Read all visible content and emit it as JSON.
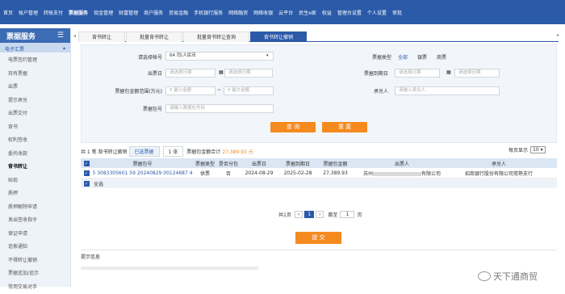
{
  "nav": [
    "首页",
    "账户管理",
    "转账支付",
    "票据服务",
    "现金管理",
    "财富管理",
    "商户服务",
    "贸易金融",
    "手机银行服务",
    "网络融资",
    "网络收银",
    "云平台",
    "民生e家",
    "权益",
    "管理台设置",
    "个人设置",
    "审批"
  ],
  "sidebar": {
    "title": "票据服务",
    "section": "电子汇票",
    "items": [
      "电票签约管理",
      "持有票据",
      "出票",
      "提示承兑",
      "出票交付",
      "背书",
      "权利签收",
      "委托收款",
      "背书转让",
      "贴现",
      "质押",
      "质押解除申请",
      "发出签收指令",
      "保证申请",
      "追索通知",
      "不得转让撤销",
      "票据追加/追示",
      "常用交易对手"
    ]
  },
  "tabs": [
    "背书转让",
    "批量背书转让",
    "批量背书转让查询",
    "背书转让撤销"
  ],
  "form": {
    "account_label": "请选择帐号",
    "account_value": "64                          司(人民币",
    "issue_date_label": "出票日",
    "due_date_label": "票据到期日",
    "amount_label": "票据包金额范围(万元)",
    "payee_label": "承兑人",
    "bill_no_label": "票据包号",
    "date_ph_start": "请选择日期",
    "date_ph_end": "请选择日期",
    "amount_ph_min": "¥ 最小金额",
    "amount_ph_max": "¥ 最大金额",
    "payee_ph": "请输入承兑人",
    "bill_ph": "请输入票据包号码",
    "type_label": "票据类型",
    "type_options": [
      "全部",
      "银票",
      "商票"
    ],
    "query": "查 询",
    "reset": "重 置"
  },
  "summary": {
    "total": "共 1 笔 背书转让撤销",
    "selected_label": "已选票据",
    "selected_count": "1 张",
    "sum_label": "票据包金额合计",
    "sum_value": "27,389.93 元",
    "page_show": "每页显示",
    "page_size": "10"
  },
  "table": {
    "headers": [
      "票据包号",
      "票据类型",
      "是否分包",
      "出票日",
      "票据到期日",
      "票据包金额",
      "出票人",
      "承兑人"
    ],
    "rows": [
      {
        "bill_no": "5 3083305601 59 20240829 00124687 4",
        "type": "供票",
        "split": "否",
        "issue": "2024-08-29",
        "due": "2025-02-28",
        "amount": "27,389.93",
        "drawer_prefix": "苏州",
        "drawer_suffix": "有限公司",
        "acceptor": "招商银行股份有限公司常熟支行"
      }
    ],
    "footer_all": "全选"
  },
  "pager": {
    "total_pages": "共1页",
    "page": "1",
    "goto": "跳至",
    "goto_val": "1",
    "page_word": "页"
  },
  "submit": "提 交",
  "tips": "提示信息",
  "watermark": "天下通商贸"
}
